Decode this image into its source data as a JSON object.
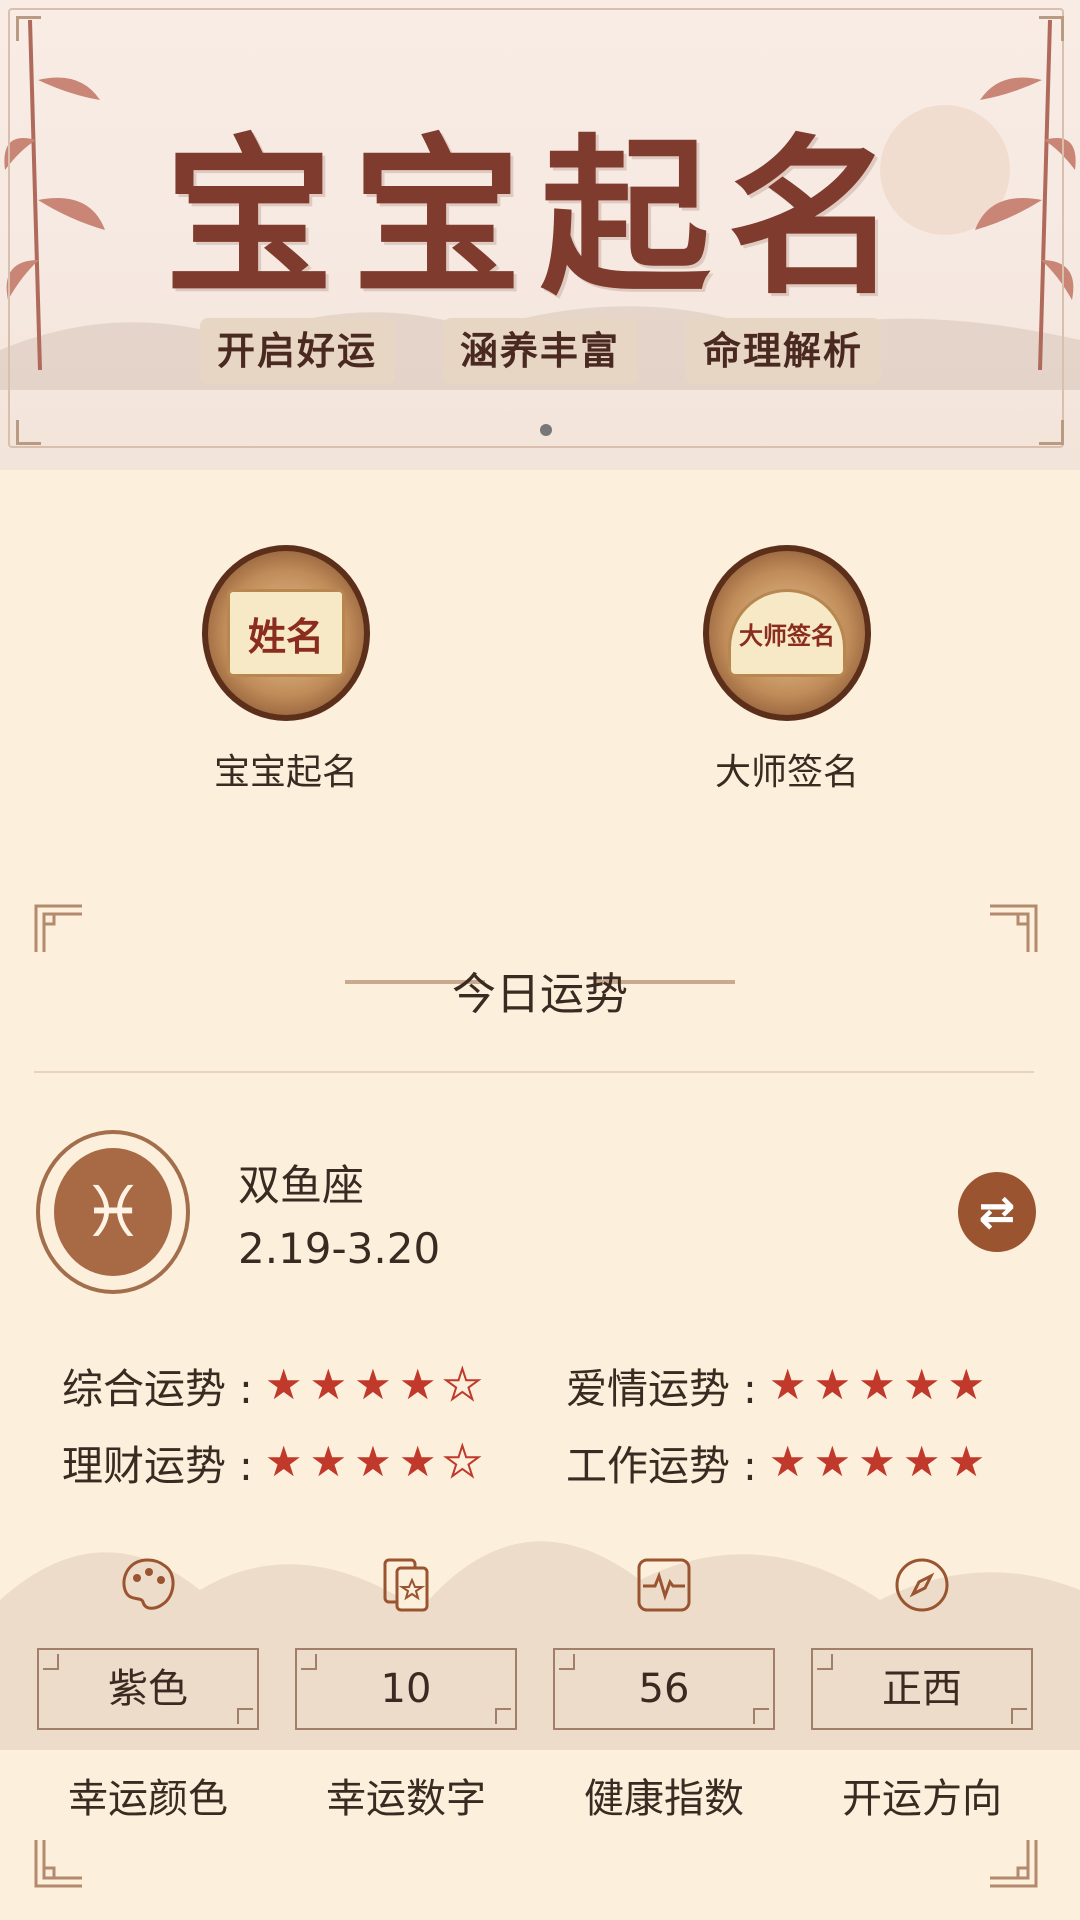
{
  "banner": {
    "title": "宝宝起名",
    "tags": [
      "开启好运",
      "涵养丰富",
      "命理解析"
    ]
  },
  "features": [
    {
      "label": "宝宝起名",
      "badge": "姓名"
    },
    {
      "label": "大师签名",
      "badge": "大师签名"
    }
  ],
  "today": {
    "section_title": "今日运势",
    "zodiac_name": "双鱼座",
    "zodiac_dates": "2.19-3.20",
    "fortunes": [
      {
        "label": "综合运势 :",
        "stars": 4,
        "max": 5
      },
      {
        "label": "爱情运势 :",
        "stars": 5,
        "max": 5
      },
      {
        "label": "理财运势 :",
        "stars": 4,
        "max": 5
      },
      {
        "label": "工作运势 :",
        "stars": 5,
        "max": 5
      }
    ],
    "lucky": [
      {
        "icon": "palette-icon",
        "value": "紫色",
        "label": "幸运颜色"
      },
      {
        "icon": "card-icon",
        "value": "10",
        "label": "幸运数字"
      },
      {
        "icon": "pulse-icon",
        "value": "56",
        "label": "健康指数"
      },
      {
        "icon": "compass-icon",
        "value": "正西",
        "label": "开运方向"
      }
    ]
  },
  "colors": {
    "accent": "#9a5430",
    "star": "#c0392b",
    "background": "#fcefdc"
  }
}
